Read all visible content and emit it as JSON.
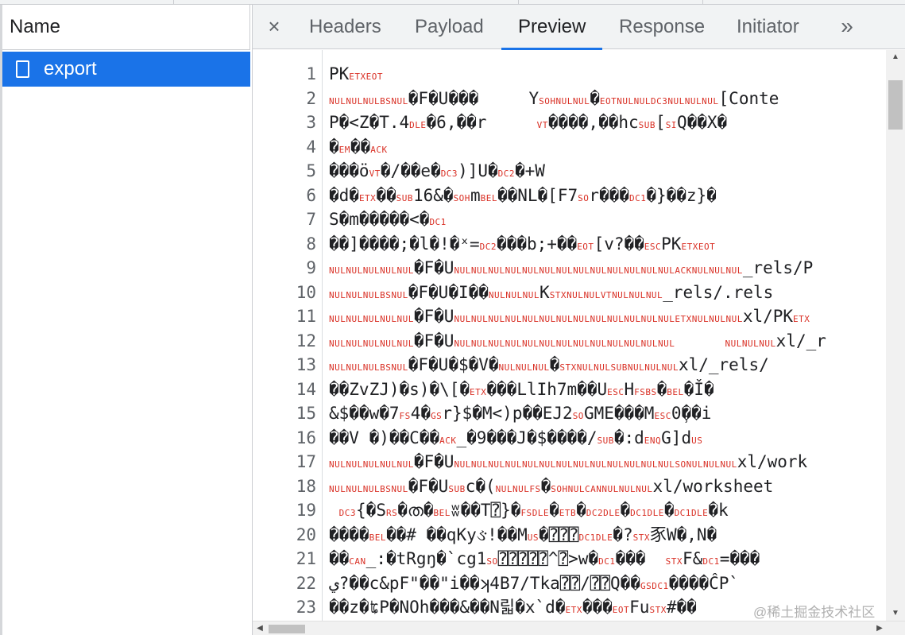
{
  "left_panel": {
    "column_header": "Name",
    "requests": [
      {
        "name": "export",
        "selected": true
      }
    ]
  },
  "detail_panel": {
    "close_glyph": "×",
    "tabs": [
      {
        "label": "Headers",
        "active": false
      },
      {
        "label": "Payload",
        "active": false
      },
      {
        "label": "Preview",
        "active": true
      },
      {
        "label": "Response",
        "active": false
      },
      {
        "label": "Initiator",
        "active": false
      }
    ],
    "more_tabs_glyph": "»"
  },
  "preview": {
    "line_numbers": [
      "1",
      "2",
      "3",
      "4",
      "5",
      "6",
      "7",
      "8",
      "9",
      "10",
      "11",
      "12",
      "13",
      "14",
      "15",
      "16",
      "17",
      "18",
      "19",
      "20",
      "21",
      "22",
      "23"
    ],
    "lines": [
      "PK{ETX}{EOT}",
      "{NUL}{NUL}{NUL}{BS}{NUL}�F�U���     Y{SOH}{NUL}{NUL}�{EOT}{NUL}{NUL}{DC3}{NUL}{NUL}{NUL}[Conte",
      "P�<Z�T.4{DLE}�6,��r     {VT}����,��hc{SUB}[{SI}Q��X�",
      "�{EM}��{ACK}",
      "���ö{VT}�/��e�{DC3})]U�{DC2}�+W",
      "�d�{ETX}��{SUB}16&�{SOH}m{BEL}��NL�[F7{SO}r���{DC1}�}��z}�",
      "S�m�����<�{DC1}",
      "��]����;�l�!�ˣ={DC2}���b;+��{EOT}[v?��{ESC}PK{ETX}{EOT}",
      "{NUL}{NUL}{NUL}{NUL}{NUL}�F�U{NUL}{NUL}{NUL}{NUL}{NUL}{NUL}{NUL}{NUL}{NUL}{NUL}{NUL}{NUL}{NUL}{ACK}{NUL}{NUL}{NUL}_rels/P",
      "{NUL}{NUL}{NUL}{BS}{NUL}�F�U�I��{NUL}{NUL}{NUL}K{STX}{NUL}{NUL}{VT}{NUL}{NUL}{NUL}_rels/.rels",
      "{NUL}{NUL}{NUL}{NUL}{NUL}�F�U{NUL}{NUL}{NUL}{NUL}{NUL}{NUL}{NUL}{NUL}{NUL}{NUL}{NUL}{NUL}{NUL}{ETX}{NUL}{NUL}{NUL}xl/PK{ETX}",
      "{NUL}{NUL}{NUL}{NUL}{NUL}�F�U{NUL}{NUL}{NUL}{NUL}{NUL}{NUL}{NUL}{NUL}{NUL}{NUL}{NUL}{NUL}{NUL}     {NUL}{NUL}{NUL}xl/_r",
      "{NUL}{NUL}{NUL}{BS}{NUL}�F�U�$�V�{NUL}{NUL}{NUL}�{STX}{NUL}{NUL}{SUB}{NUL}{NUL}{NUL}xl/_rels/",
      "��ZvZJ)�s)�\\[�{ETX}���LlIh7m��U{ESC}H{FS}{BS}�{BEL}�Ǐ�",
      "&$��w�7{FS}4�{GS}r}$�M<)p��EJ2{SO}GME���M{ESC}0̹��i",
      "��V �)��C��{ACK}_�9���J�$����/{SUB}�:d{ENQ}G]d{US}",
      "{NUL}{NUL}{NUL}{NUL}{NUL}�F�U{NUL}{NUL}{NUL}{NUL}{NUL}{NUL}{NUL}{NUL}{NUL}{NUL}{NUL}{NUL}{NUL}{SO}{NUL}{NUL}{NUL}xl/work",
      "{NUL}{NUL}{NUL}{BS}{NUL}�F�U{SUB}c�({NUL}{NUL}{FS}�{SOH}{NUL}{CAN}{NUL}{NUL}{NUL}xl/worksheet",
      " {DC3}{�S{RS}�ത�{BEL}ʬ��T⍰}�{FS}{DLE}�{ETB}�{DC2}{DLE}�{DC1}{DLE}�{DC1}{DLE}�k",
      "����{BEL}��# ��qKyઙ!��M{US}�⍰⍰⍰{DC1}{DLE}�?{STX}豕W�,N�",
      "��{CAN}_:�tRgŋ�`cg1{SO}⍰⍰⍰⍰⍰^⍰>w�{DC1}���  {STX}F&{DC1}=���",
      "ي?��c&pF\"��\"i��ʞ4B7/Tka⍰⍰/⍰⍰Q��{GS}{DC1}����ĈP`",
      "��z�ʨP�NOh���&��N릷�x`d�{ETX}���{EOT}Fu{STX}#��"
    ]
  },
  "scrollbars": {
    "up_arrow": "▲",
    "down_arrow": "▼",
    "left_arrow": "◀",
    "right_arrow": "▶"
  },
  "watermark": "@稀土掘金技术社区"
}
